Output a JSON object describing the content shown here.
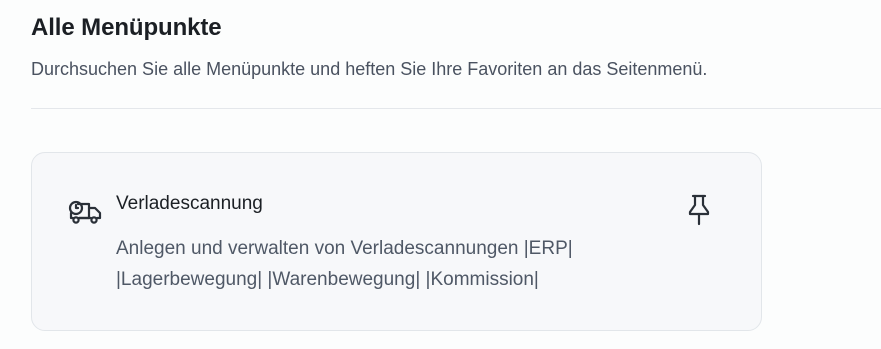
{
  "header": {
    "title": "Alle Menüpunkte",
    "subtitle": "Durchsuchen Sie alle Menüpunkte und heften Sie Ihre Favoriten an das Seitenmenü."
  },
  "menu_items": [
    {
      "title": "Verladescannung",
      "description": "Anlegen und verwalten von Verladescannungen |ERP| |Lagerbewegung| |Warenbewegung| |Kommission|",
      "icon": "truck-clock-icon",
      "action_icon": "pin-icon"
    }
  ],
  "colors": {
    "background": "#fcfdfd",
    "card_background": "#f7f8fa",
    "card_border": "#e2e6ea",
    "text_primary": "#1b1f24",
    "text_secondary": "#4f5866"
  }
}
